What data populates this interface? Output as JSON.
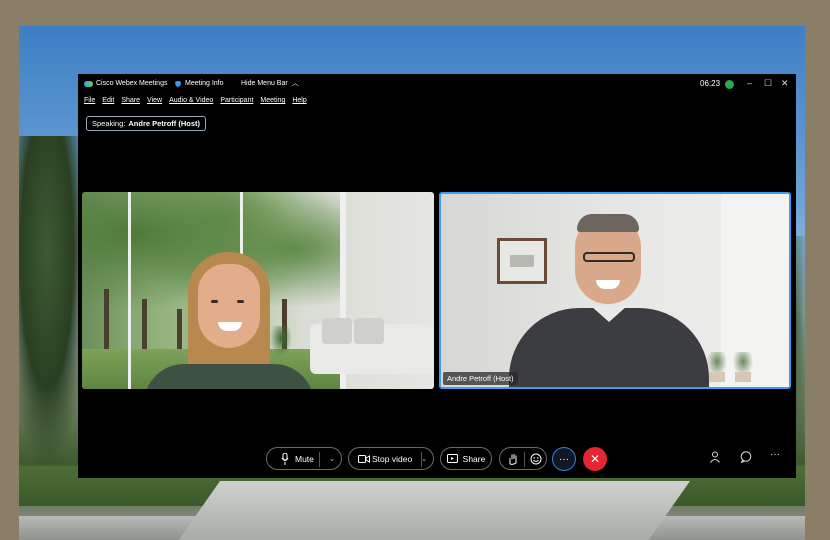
{
  "app": {
    "title": "Cisco Webex Meetings",
    "meeting_info_label": "Meeting Info",
    "hide_menu_label": "Hide Menu Bar",
    "clock": "06:23"
  },
  "window_controls": {
    "minimize": "–",
    "maximize": "☐",
    "close": "✕"
  },
  "menu": [
    "File",
    "Edit",
    "Share",
    "View",
    "Audio & Video",
    "Participant",
    "Meeting",
    "Help"
  ],
  "speaking": {
    "prefix": "Speaking:",
    "name": "Andre Petroff (Host)"
  },
  "participants": {
    "right_name": "Andre Petroff (Host)"
  },
  "controls": {
    "mute_label": "Mute",
    "stop_video_label": "Stop video",
    "share_label": "Share",
    "more_label": "···"
  },
  "colors": {
    "accent": "#3d9bf0",
    "end_call": "#e3262f",
    "status_online": "#2aa84f"
  },
  "icons": [
    "webex-logo-icon",
    "shield-icon",
    "chevron-up-icon",
    "microphone-icon",
    "video-camera-icon",
    "share-screen-icon",
    "raise-hand-icon",
    "reactions-icon",
    "more-icon",
    "end-call-icon",
    "participants-icon",
    "chat-icon",
    "more-options-icon"
  ]
}
